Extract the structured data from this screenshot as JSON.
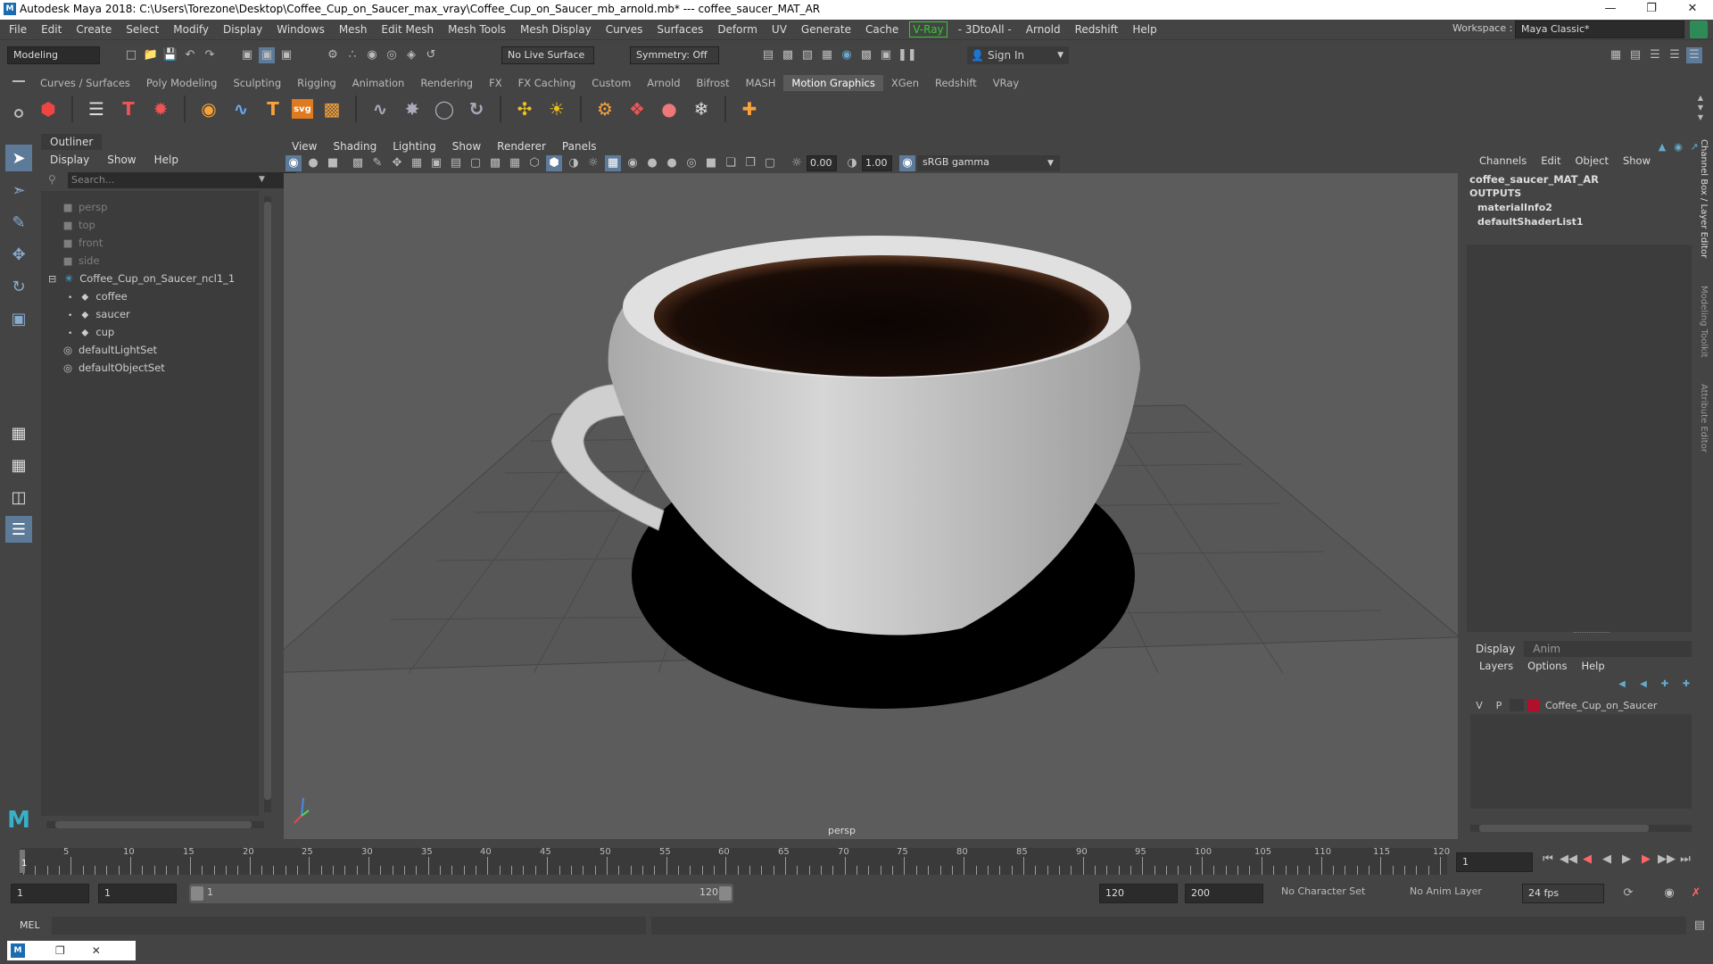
{
  "app": {
    "title": "Autodesk Maya 2018: C:\\Users\\Torezone\\Desktop\\Coffee_Cup_on_Saucer_max_vray\\Coffee_Cup_on_Saucer_mb_arnold.mb*  ---  coffee_saucer_MAT_AR",
    "logo": "M"
  },
  "menubar": [
    "File",
    "Edit",
    "Create",
    "Select",
    "Modify",
    "Display",
    "Windows",
    "Mesh",
    "Edit Mesh",
    "Mesh Tools",
    "Mesh Display",
    "Curves",
    "Surfaces",
    "Deform",
    "UV",
    "Generate",
    "Cache",
    "V-Ray",
    "- 3DtoAll -",
    "Arnold",
    "Redshift",
    "Help"
  ],
  "workspace": {
    "label": "Workspace :",
    "value": "Maya Classic*"
  },
  "statusline": {
    "mode": "Modeling",
    "live_surface": "No Live Surface",
    "symmetry": "Symmetry: Off",
    "sign_in": "Sign In"
  },
  "shelf_tabs": [
    "Curves / Surfaces",
    "Poly Modeling",
    "Sculpting",
    "Rigging",
    "Animation",
    "Rendering",
    "FX",
    "FX Caching",
    "Custom",
    "Arnold",
    "Bifrost",
    "MASH",
    "Motion Graphics",
    "XGen",
    "Redshift",
    "VRay"
  ],
  "shelf_active": "Motion Graphics",
  "outliner": {
    "title": "Outliner",
    "menu": [
      "Display",
      "Show",
      "Help"
    ],
    "search_placeholder": "Search...",
    "items": [
      {
        "label": "persp",
        "icon": "camera-icon",
        "dim": true
      },
      {
        "label": "top",
        "icon": "camera-icon",
        "dim": true
      },
      {
        "label": "front",
        "icon": "camera-icon",
        "dim": true
      },
      {
        "label": "side",
        "icon": "camera-icon",
        "dim": true
      },
      {
        "label": "Coffee_Cup_on_Saucer_ncl1_1",
        "icon": "group-icon",
        "dim": false
      },
      {
        "label": "coffee",
        "icon": "mesh-icon",
        "dim": false
      },
      {
        "label": "saucer",
        "icon": "mesh-icon",
        "dim": false
      },
      {
        "label": "cup",
        "icon": "mesh-icon",
        "dim": false
      },
      {
        "label": "defaultLightSet",
        "icon": "set-icon",
        "dim": false
      },
      {
        "label": "defaultObjectSet",
        "icon": "set-icon",
        "dim": false
      }
    ]
  },
  "viewport": {
    "menu": [
      "View",
      "Shading",
      "Lighting",
      "Show",
      "Renderer",
      "Panels"
    ],
    "exposure": "0.00",
    "gamma": "1.00",
    "color_space": "sRGB gamma",
    "camera_label": "persp"
  },
  "channel_box": {
    "menu": [
      "Channels",
      "Edit",
      "Object",
      "Show"
    ],
    "node": "coffee_saucer_MAT_AR",
    "outputs_label": "OUTPUTS",
    "outputs": [
      "materialInfo2",
      "defaultShaderList1"
    ]
  },
  "layer_editor": {
    "tabs": [
      "Display",
      "Anim"
    ],
    "menu": [
      "Layers",
      "Options",
      "Help"
    ],
    "layer": {
      "v": "V",
      "p": "P",
      "name": "Coffee_Cup_on_Saucer",
      "color": "#b0102a"
    }
  },
  "side_tabs": [
    "Channel Box / Layer Editor",
    "Modeling Toolkit",
    "Attribute Editor"
  ],
  "timeline": {
    "ticks": [
      "5",
      "10",
      "15",
      "20",
      "25",
      "30",
      "35",
      "40",
      "45",
      "50",
      "55",
      "60",
      "65",
      "70",
      "75",
      "80",
      "85",
      "90",
      "95",
      "100",
      "105",
      "110",
      "115",
      "120"
    ],
    "current_frame_marker": "1",
    "current_frame": "1"
  },
  "range": {
    "start": "1",
    "anim_start": "1",
    "range_start": "1",
    "range_end": "120",
    "end": "120",
    "anim_end": "200",
    "character_set": "No Character Set",
    "anim_layer": "No Anim Layer",
    "fps": "24 fps"
  },
  "cmdline": {
    "label": "MEL"
  }
}
